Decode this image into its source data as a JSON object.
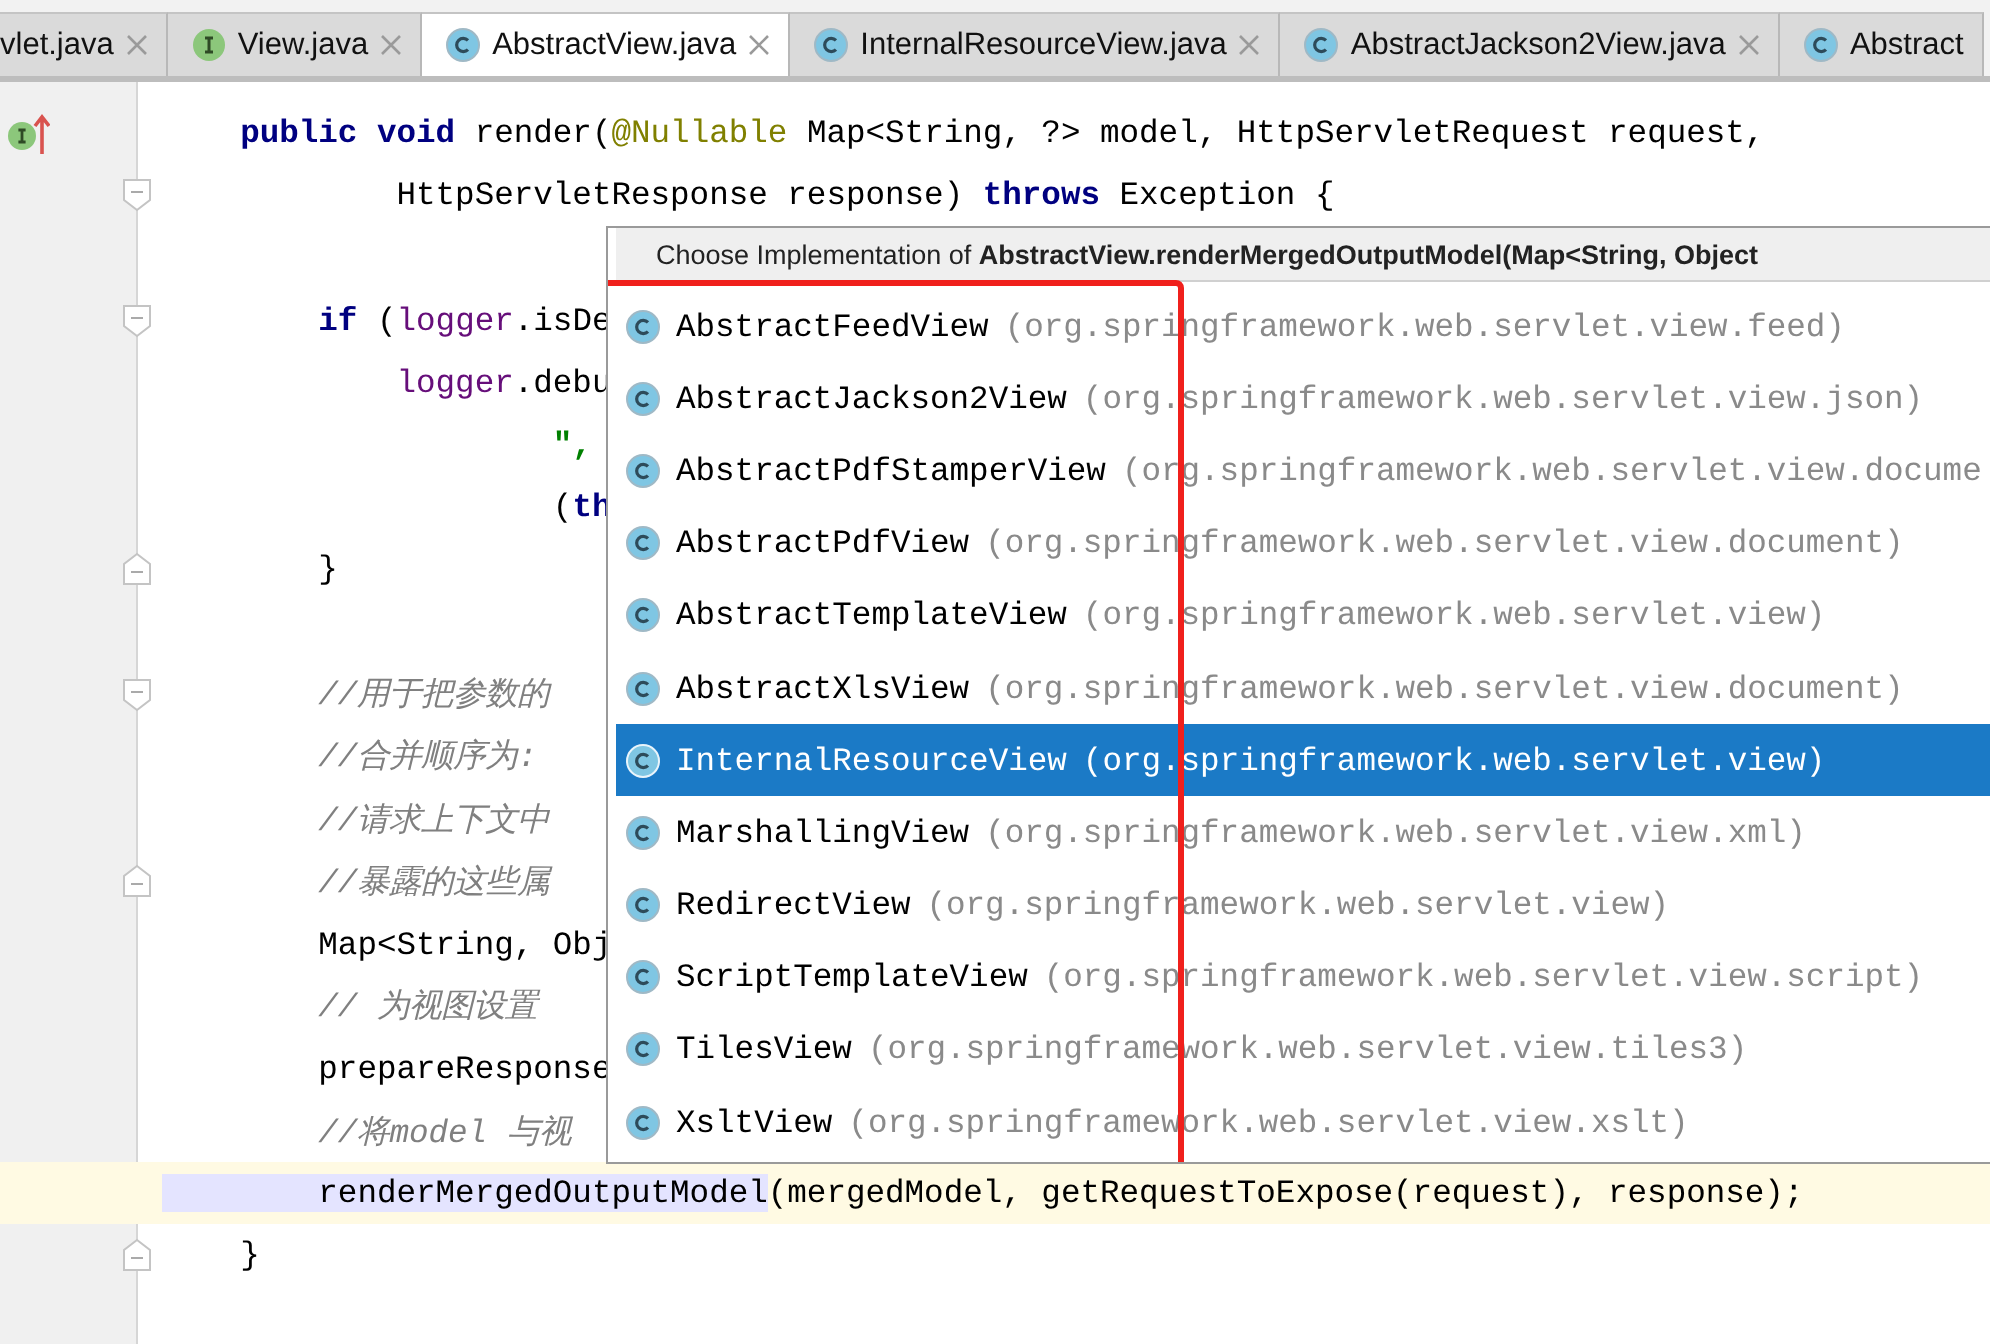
{
  "tabs": [
    {
      "label": "vlet.java",
      "kind": "plain",
      "selected": false
    },
    {
      "label": "View.java",
      "kind": "interface",
      "selected": false
    },
    {
      "label": "AbstractView.java",
      "kind": "class",
      "selected": true
    },
    {
      "label": "InternalResourceView.java",
      "kind": "class",
      "selected": false
    },
    {
      "label": "AbstractJackson2View.java",
      "kind": "class",
      "selected": false
    },
    {
      "label": "Abstract",
      "kind": "class",
      "selected": false
    }
  ],
  "editor": {
    "lines": [
      {
        "kind": "implements",
        "current": false,
        "tokens": [
          {
            "kind": "keyword",
            "text": "    public void"
          },
          {
            "kind": "plain",
            "text": " render("
          },
          {
            "kind": "annotation",
            "text": "@Nullable"
          },
          {
            "kind": "plain",
            "text": " Map<String, ?> model, HttpServletRequest request,"
          }
        ]
      },
      {
        "kind": "fold-start",
        "current": false,
        "tokens": [
          {
            "kind": "plain",
            "text": "            HttpServletResponse response) "
          },
          {
            "kind": "keyword",
            "text": "throws"
          },
          {
            "kind": "plain",
            "text": " Exception {"
          }
        ]
      },
      {
        "kind": "plain",
        "current": false
      },
      {
        "kind": "fold-start",
        "current": false,
        "tokens": [
          {
            "kind": "keyword",
            "text": "        if"
          },
          {
            "kind": "plain",
            "text": " ("
          },
          {
            "kind": "field",
            "text": "logger"
          },
          {
            "kind": "plain",
            "text": ".isDe"
          }
        ]
      },
      {
        "kind": "plain",
        "current": false,
        "tokens": [
          {
            "kind": "field",
            "text": "            logger"
          },
          {
            "kind": "plain",
            "text": ".debu"
          }
        ]
      },
      {
        "kind": "plain",
        "current": false,
        "tokens": [
          {
            "kind": "string",
            "text": "                    \","
          }
        ]
      },
      {
        "kind": "plain",
        "current": false,
        "tokens": [
          {
            "kind": "plain",
            "text": "                    ("
          },
          {
            "kind": "keyword",
            "text": "th"
          }
        ]
      },
      {
        "kind": "fold-end",
        "current": false,
        "tokens": [
          {
            "kind": "plain",
            "text": "        }"
          }
        ]
      },
      {
        "kind": "plain",
        "current": false
      },
      {
        "kind": "fold-start",
        "current": false,
        "tokens": [
          {
            "kind": "comment",
            "text": "        //用于把参数的"
          }
        ]
      },
      {
        "kind": "plain",
        "current": false,
        "tokens": [
          {
            "kind": "comment",
            "text": "        //合并顺序为:"
          }
        ]
      },
      {
        "kind": "plain",
        "current": false,
        "tokens": [
          {
            "kind": "comment",
            "text": "        //请求上下文中"
          }
        ]
      },
      {
        "kind": "fold-end",
        "current": false,
        "tokens": [
          {
            "kind": "comment",
            "text": "        //暴露的这些属"
          }
        ]
      },
      {
        "kind": "plain",
        "current": false,
        "tokens": [
          {
            "kind": "plain",
            "text": "        Map<String, Obj"
          }
        ]
      },
      {
        "kind": "plain",
        "current": false,
        "tokens": [
          {
            "kind": "comment",
            "text": "        // 为视图设置"
          }
        ]
      },
      {
        "kind": "plain",
        "current": false,
        "tokens": [
          {
            "kind": "plain",
            "text": "        prepareResponse"
          }
        ]
      },
      {
        "kind": "plain",
        "current": false,
        "tokens": [
          {
            "kind": "comment",
            "text": "        //将model 与视"
          }
        ]
      },
      {
        "kind": "plain",
        "current": true,
        "tokens": [
          {
            "kind": "usage",
            "text": "        renderMergedOutputModel"
          },
          {
            "kind": "plain",
            "text": "(mergedModel, getRequestToExpose(request), response);"
          }
        ]
      },
      {
        "kind": "fold-end",
        "current": false,
        "tokens": [
          {
            "kind": "plain",
            "text": "    }"
          }
        ]
      }
    ]
  },
  "popup": {
    "title": "Choose Implementation of **AbstractView.renderMergedOutputModel(Map<String, Object**",
    "items": [
      {
        "name": "AbstractFeedView",
        "package": "(org.springframework.web.servlet.view.feed)",
        "selected": false
      },
      {
        "name": "AbstractJackson2View",
        "package": "(org.springframework.web.servlet.view.json)",
        "selected": false
      },
      {
        "name": "AbstractPdfStamperView",
        "package": "(org.springframework.web.servlet.view.docume",
        "selected": false
      },
      {
        "name": "AbstractPdfView",
        "package": "(org.springframework.web.servlet.view.document)",
        "selected": false
      },
      {
        "name": "AbstractTemplateView",
        "package": "(org.springframework.web.servlet.view)",
        "selected": false
      },
      {
        "name": "AbstractXlsView",
        "package": "(org.springframework.web.servlet.view.document)",
        "selected": false
      },
      {
        "name": "InternalResourceView",
        "package": "(org.springframework.web.servlet.view)",
        "selected": true
      },
      {
        "name": "MarshallingView",
        "package": "(org.springframework.web.servlet.view.xml)",
        "selected": false
      },
      {
        "name": "RedirectView",
        "package": "(org.springframework.web.servlet.view)",
        "selected": false
      },
      {
        "name": "ScriptTemplateView",
        "package": "(org.springframework.web.servlet.view.script)",
        "selected": false
      },
      {
        "name": "TilesView",
        "package": "(org.springframework.web.servlet.view.tiles3)",
        "selected": false
      },
      {
        "name": "XsltView",
        "package": "(org.springframework.web.servlet.view.xslt)",
        "selected": false
      }
    ]
  }
}
